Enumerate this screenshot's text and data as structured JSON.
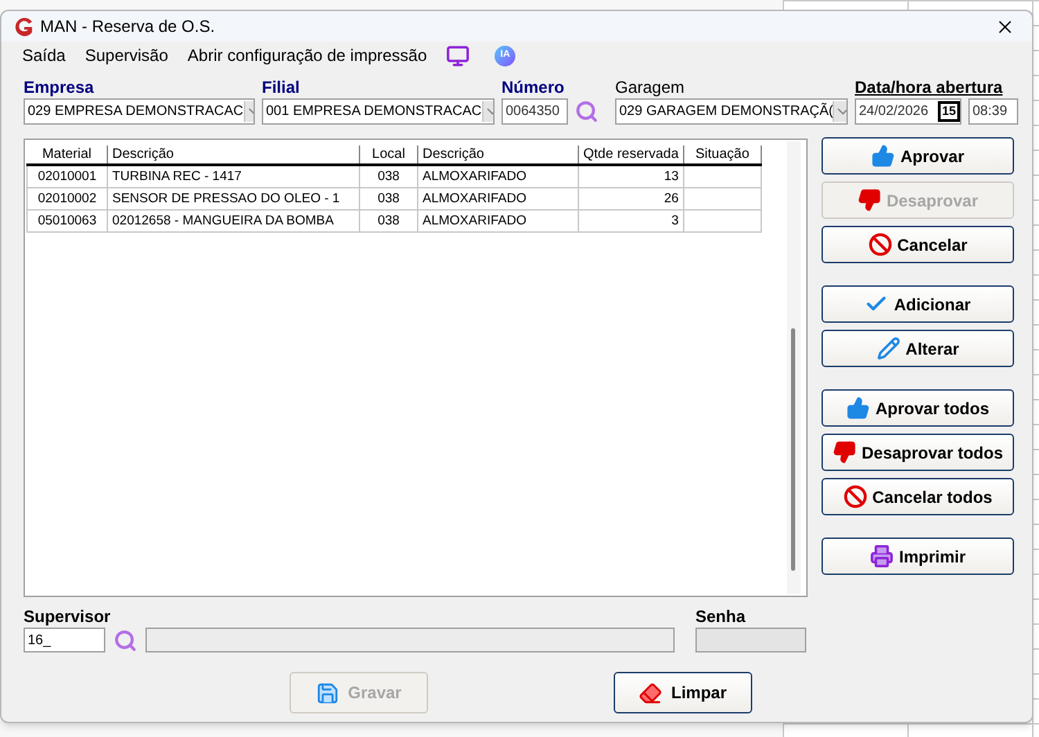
{
  "window": {
    "title": "MAN - Reserva de O.S."
  },
  "menu": [
    {
      "kind": "text",
      "label": "Saída"
    },
    {
      "kind": "text",
      "label": "Supervisão"
    },
    {
      "kind": "text",
      "label": "Abrir configuração de impressão"
    },
    {
      "kind": "monitor"
    },
    {
      "kind": "ai",
      "label": "IA"
    }
  ],
  "header_fields": [
    {
      "label": "Empresa",
      "kind": "combo",
      "value": "029 EMPRESA DEMONSTRACAC"
    },
    {
      "label": "Filial",
      "kind": "combo",
      "value": "001 EMPRESA DEMONSTRACAC"
    },
    {
      "label": "Número",
      "kind": "search",
      "value": "0064350"
    },
    {
      "label": "Garagem",
      "kind": "combo",
      "value": "029 GARAGEM DEMONSTRAÇÃ("
    },
    {
      "label": "Data/hora abertura",
      "kind": "datetime",
      "value": "24/02/2026",
      "calendar": "15",
      "time": "08:39"
    }
  ],
  "table": {
    "columns": [
      "Material",
      "Descrição",
      "Local",
      "Descrição",
      "Qtde reservada",
      "Situação"
    ],
    "rows": [
      [
        "02010001",
        "TURBINA REC - 1417",
        "038",
        "ALMOXARIFADO",
        "13",
        ""
      ],
      [
        "02010002",
        "SENSOR DE PRESSAO DO OLEO - 1",
        "038",
        "ALMOXARIFADO",
        "26",
        ""
      ],
      [
        "05010063",
        "02012658 - MANGUEIRA DA BOMBA",
        "038",
        "ALMOXARIFADO",
        "3",
        ""
      ]
    ]
  },
  "actions": [
    [
      {
        "label": "Aprovar",
        "disabled": false
      },
      {
        "label": "Desaprovar",
        "disabled": true
      },
      {
        "label": "Cancelar",
        "disabled": false
      }
    ],
    [
      {
        "label": "Adicionar",
        "disabled": false
      },
      {
        "label": "Alterar",
        "disabled": false
      }
    ],
    [
      {
        "label": "Aprovar todos",
        "disabled": false
      },
      {
        "label": "Desaprovar todos",
        "disabled": false
      },
      {
        "label": "Cancelar todos",
        "disabled": false
      }
    ],
    [
      {
        "label": "Imprimir",
        "disabled": false
      }
    ]
  ],
  "supervisor": {
    "label": "Supervisor",
    "value": "16_"
  },
  "password": {
    "label": "Senha"
  },
  "footer_buttons": [
    {
      "label": "Gravar",
      "disabled": true
    },
    {
      "label": "Limpar",
      "disabled": false
    }
  ]
}
